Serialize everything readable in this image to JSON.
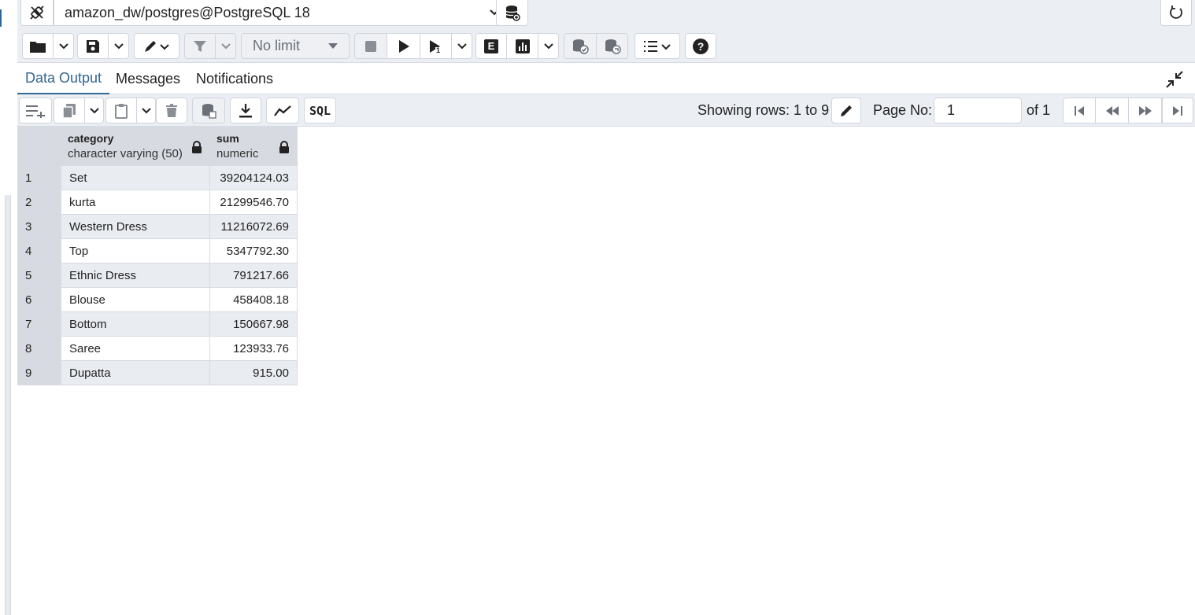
{
  "connection": {
    "label": "amazon_dw/postgres@PostgreSQL 18"
  },
  "toolbar": {
    "limit_label": "No limit",
    "explain_label": "E",
    "sql_label": "SQL"
  },
  "tabs": [
    {
      "label": "Data Output",
      "active": true
    },
    {
      "label": "Messages",
      "active": false
    },
    {
      "label": "Notifications",
      "active": false
    }
  ],
  "grid_toolbar": {
    "rows_info": "Showing rows: 1 to 9",
    "page_label": "Page No:",
    "page_value": "1",
    "page_of": "of 1"
  },
  "table": {
    "columns": [
      {
        "name": "category",
        "type": "character varying (50)"
      },
      {
        "name": "sum",
        "type": "numeric"
      }
    ],
    "rows": [
      {
        "n": "1",
        "category": "Set",
        "sum": "39204124.03"
      },
      {
        "n": "2",
        "category": "kurta",
        "sum": "21299546.70"
      },
      {
        "n": "3",
        "category": "Western Dress",
        "sum": "11216072.69"
      },
      {
        "n": "4",
        "category": "Top",
        "sum": "5347792.30"
      },
      {
        "n": "5",
        "category": "Ethnic Dress",
        "sum": "791217.66"
      },
      {
        "n": "6",
        "category": "Blouse",
        "sum": "458408.18"
      },
      {
        "n": "7",
        "category": "Bottom",
        "sum": "150667.98"
      },
      {
        "n": "8",
        "category": "Saree",
        "sum": "123933.76"
      },
      {
        "n": "9",
        "category": "Dupatta",
        "sum": "915.00"
      }
    ]
  },
  "colors": {
    "accent": "#326690",
    "toolbar_bg": "#ebeef3",
    "header_bg": "#d7dbe1",
    "stripe": "#e9ecf1"
  }
}
